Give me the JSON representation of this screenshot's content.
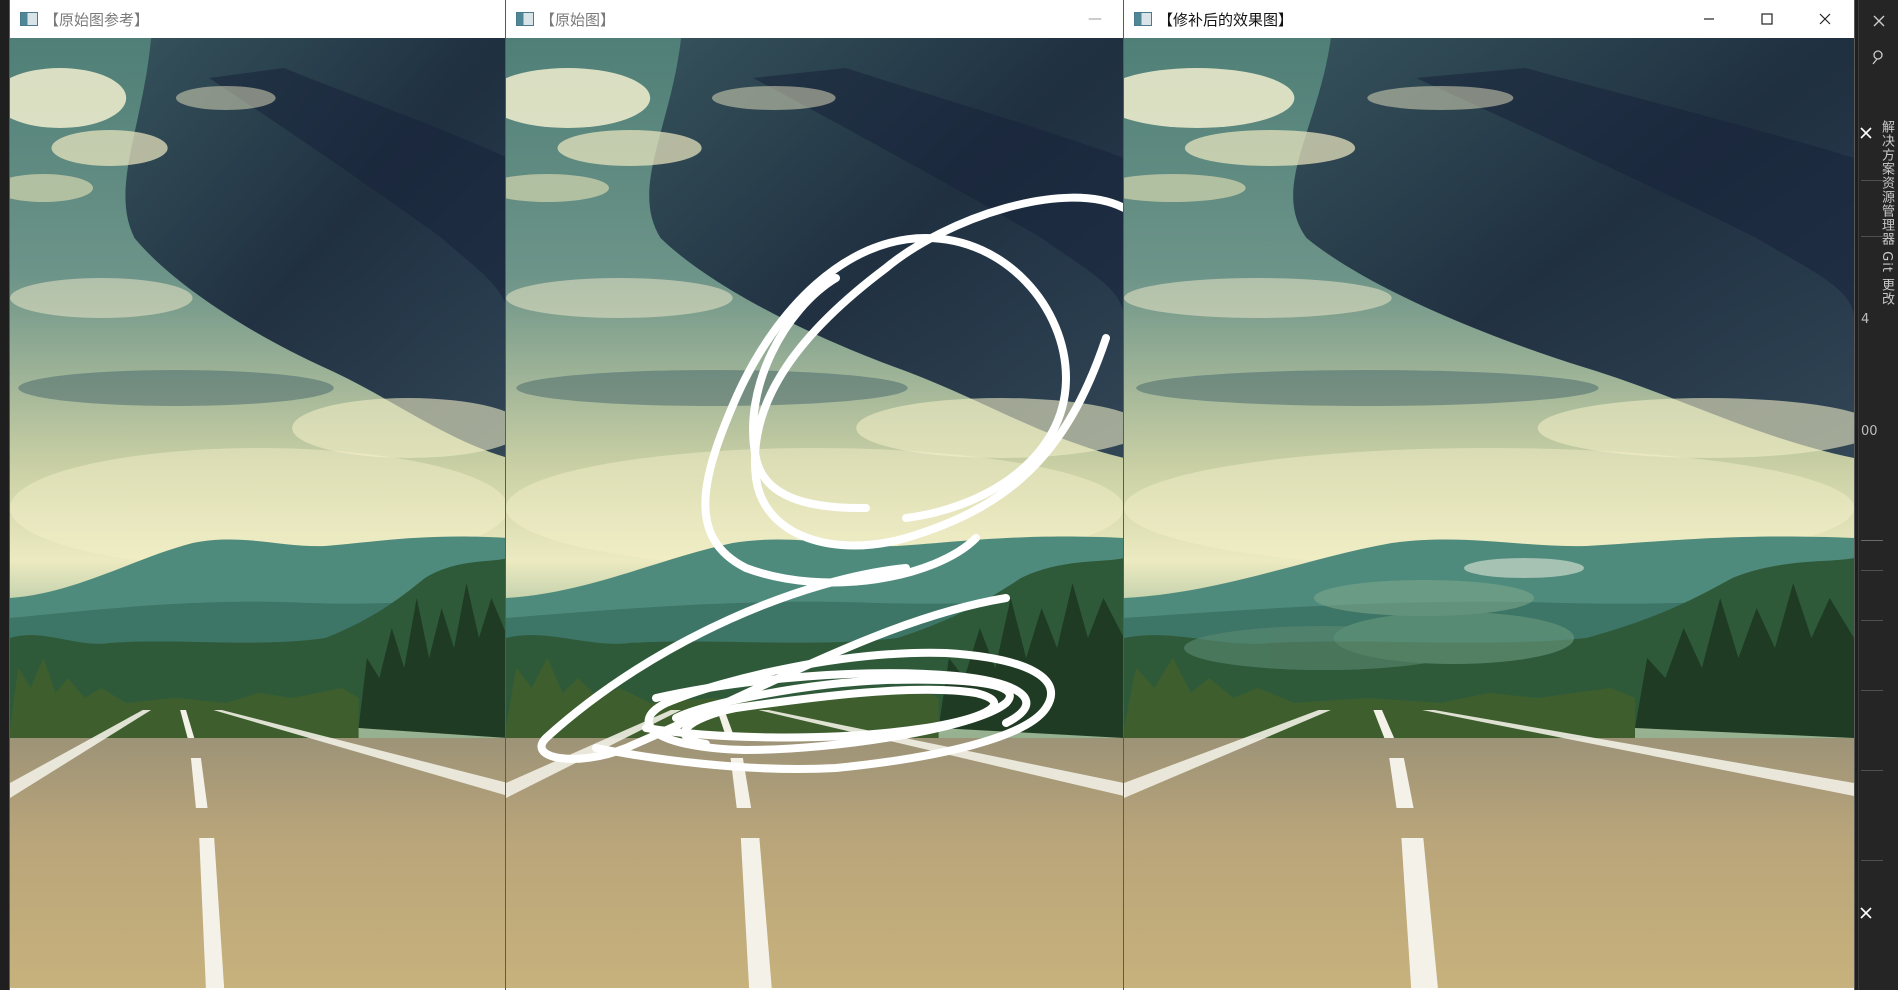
{
  "windows": [
    {
      "title": "【原始图参考】",
      "state": "inactive"
    },
    {
      "title": "【原始图】",
      "state": "inactive",
      "minimize_glyph": "—"
    },
    {
      "title": "【修补后的效果图】",
      "state": "active"
    }
  ],
  "side_panel": {
    "vertical_text": "解决方案资源管理器  Git 更改",
    "fragments": [
      "4",
      "00"
    ]
  },
  "icons": {
    "app": "image-window-icon",
    "minimize": "minimize-icon",
    "maximize": "maximize-icon",
    "close": "close-icon"
  },
  "colors": {
    "scribble": "#ffffff",
    "sky_top": "#cfe0c4",
    "cloud_dark": "#1c2b3d",
    "mountain": "#3f7f6e",
    "road": "#b9a57a"
  }
}
